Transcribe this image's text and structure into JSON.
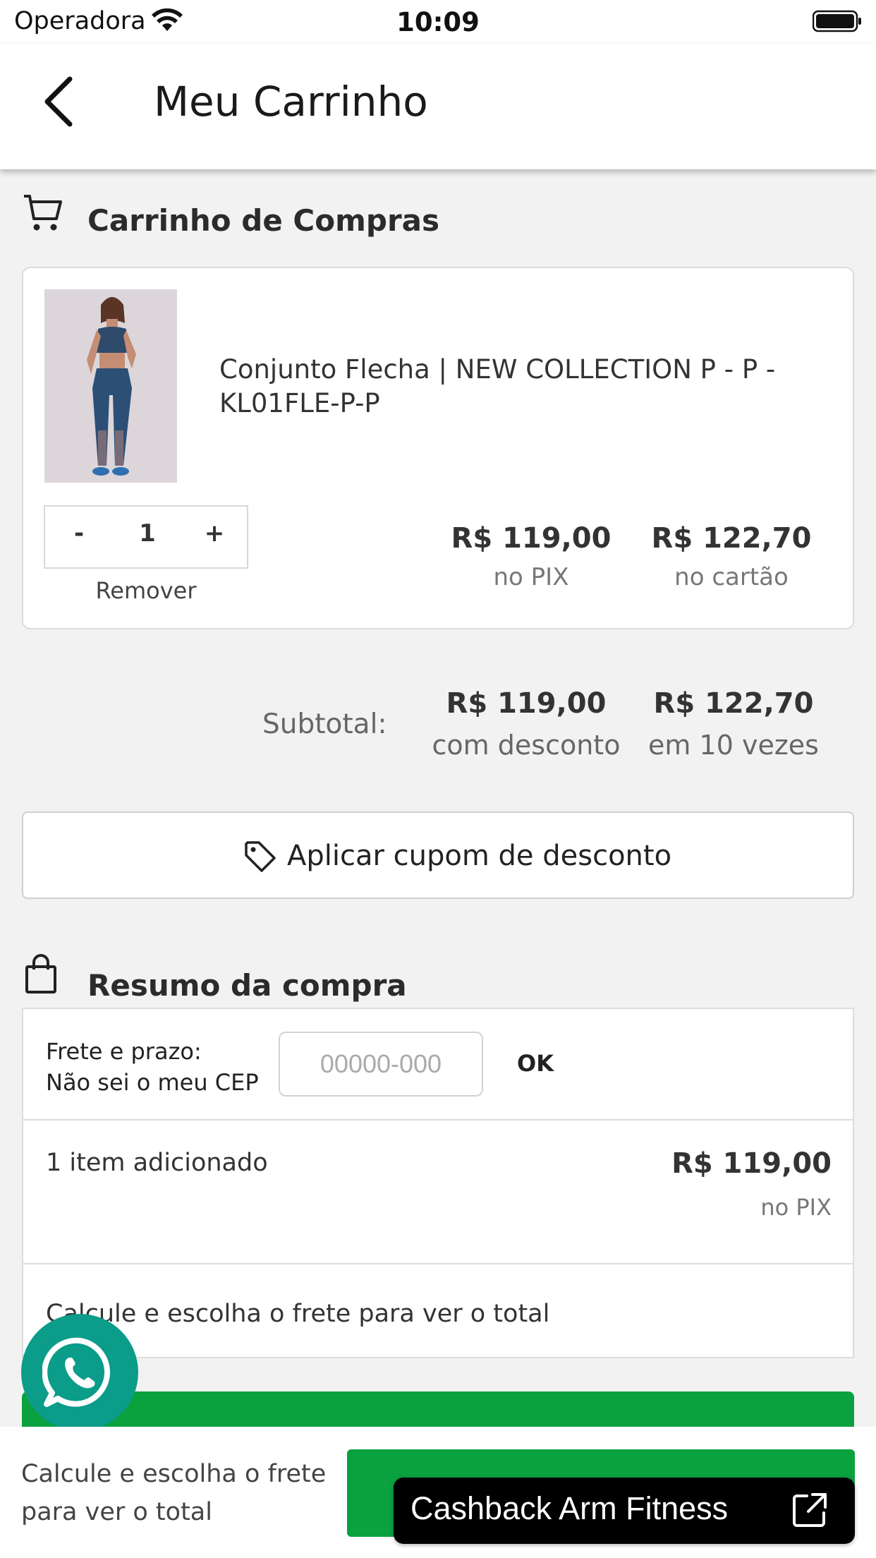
{
  "status_bar": {
    "carrier": "Operadora",
    "time": "10:09"
  },
  "header": {
    "title": "Meu Carrinho"
  },
  "cart_section": {
    "title": "Carrinho de Compras"
  },
  "product": {
    "name": "Conjunto Flecha | NEW COLLECTION P - P - KL01FLE-P-P",
    "quantity": "1",
    "minus_label": "-",
    "plus_label": "+",
    "remove_label": "Remover",
    "price_pix": "R$ 119,00",
    "price_pix_note": "no PIX",
    "price_card": "R$ 122,70",
    "price_card_note": "no cartão"
  },
  "subtotal": {
    "label": "Subtotal:",
    "discount_price": "R$ 119,00",
    "discount_note": "com desconto",
    "installment_price": "R$ 122,70",
    "installment_note": "em 10 vezes"
  },
  "coupon": {
    "label": "Aplicar cupom de desconto"
  },
  "summary_section": {
    "title": "Resumo da compra"
  },
  "summary": {
    "freight_label": "Frete e prazo:",
    "unknown_cep_link": "Não sei o meu CEP",
    "cep_placeholder": "00000-000",
    "ok_label": "OK",
    "items_label": "1 item adicionado",
    "items_price": "R$ 119,00",
    "items_price_note": "no PIX",
    "calc_note": "Calcule e escolha o frete para ver o total"
  },
  "footer": {
    "note": "Calcule e escolha o frete para ver o total"
  },
  "cashback": {
    "label": "Cashback Arm Fitness"
  },
  "colors": {
    "green": "#0aa13f",
    "whatsapp": "#0b9c8a",
    "background": "#f2f2f3"
  }
}
